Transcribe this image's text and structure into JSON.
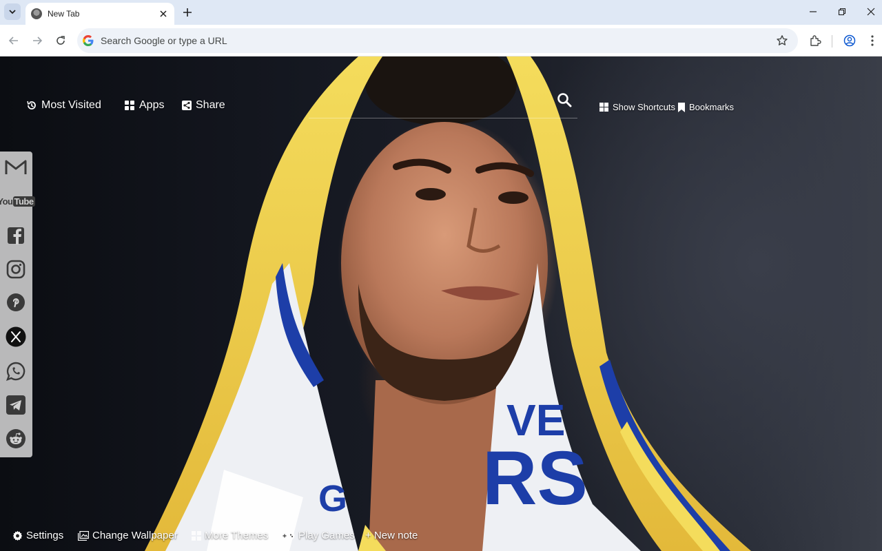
{
  "browser": {
    "tab": {
      "title": "New Tab",
      "favicon": "avatar-favicon-icon",
      "close_icon": "close-icon"
    },
    "new_tab_icon": "plus-icon",
    "tab_search_icon": "chevron-down-icon",
    "window_controls": [
      "minimize-icon",
      "restore-icon",
      "close-icon"
    ],
    "omnibox": {
      "placeholder": "Search Google or type a URL",
      "value": ""
    },
    "toolbar_icons": [
      "back-icon",
      "forward-icon",
      "reload-icon",
      "bookmark-star-icon",
      "extensions-icon",
      "profile-icon",
      "more-menu-icon"
    ]
  },
  "newtab": {
    "top_nav": {
      "most_visited": "Most Visited",
      "apps": "Apps",
      "share": "Share",
      "show_shortcuts": "Show Shortcuts",
      "bookmarks": "Bookmarks"
    },
    "search": {
      "placeholder": "",
      "icon": "search-icon"
    },
    "social_links": [
      "gmail-icon",
      "youtube-icon",
      "facebook-icon",
      "instagram-icon",
      "pinterest-icon",
      "x-icon",
      "whatsapp-icon",
      "telegram-icon",
      "reddit-icon"
    ],
    "youtube_label": "YouTube",
    "bottom_bar": {
      "settings": "Settings",
      "change_wallpaper": "Change Wallpaper",
      "more_themes": "More Themes",
      "play_games": "Play Games",
      "new_note": "+ New note"
    },
    "wallpaper": {
      "subject": "basketball-player-with-towel",
      "towel_text_1": "VE",
      "towel_text_2": "RS",
      "towel_text_3": "G"
    }
  },
  "colors": {
    "accent_blue": "#1a3fa6",
    "towel_yellow": "#f2d54a",
    "tabstrip": "#dfe8f5"
  }
}
